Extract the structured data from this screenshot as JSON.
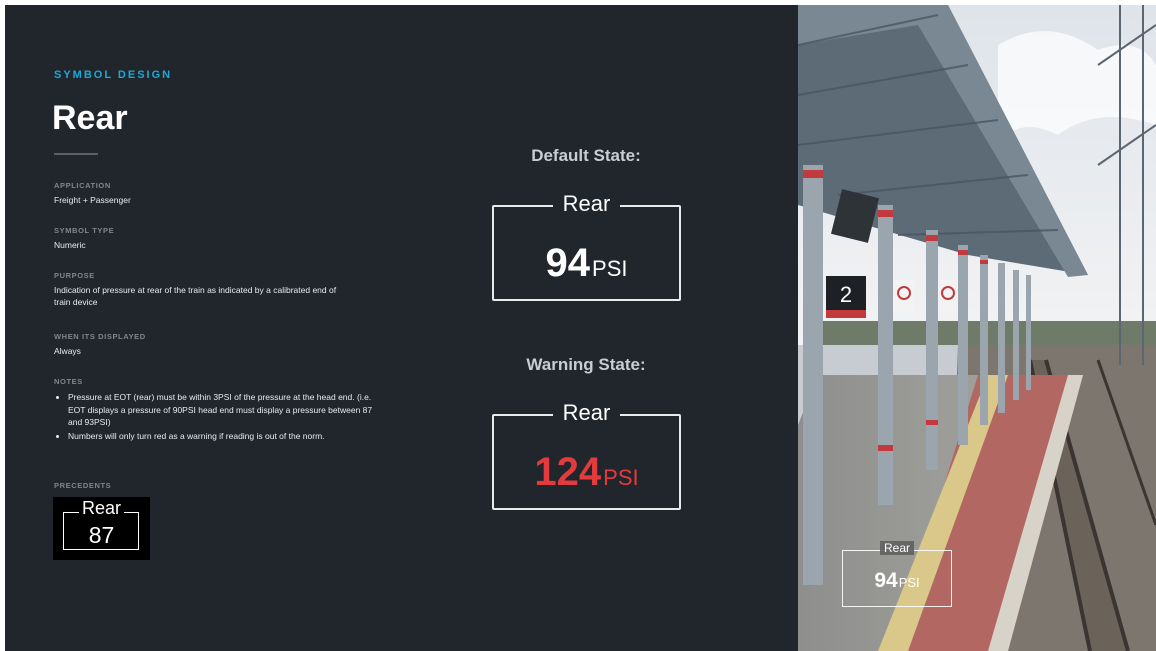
{
  "eyebrow": "SYMBOL DESIGN",
  "title": "Rear",
  "fields": {
    "application": {
      "label": "APPLICATION",
      "value": "Freight + Passenger"
    },
    "symbol_type": {
      "label": "SYMBOL TYPE",
      "value": "Numeric"
    },
    "purpose": {
      "label": "PURPOSE",
      "value": "Indication of pressure at rear of the train as indicated by a calibrated end of train device"
    },
    "when_displayed": {
      "label": "WHEN ITS DISPLAYED",
      "value": "Always"
    },
    "notes": {
      "label": "NOTES",
      "items": [
        "Pressure at EOT (rear) must be within 3PSI of the pressure at the head end. (i.e. EOT displays a pressure of 90PSI head end must display a pressure between 87 and 93PSI)",
        "Numbers will only turn red as a warning if reading is out of the norm."
      ]
    },
    "precedents": {
      "label": "PRECEDENTS",
      "symbol_label": "Rear",
      "symbol_value": "87"
    }
  },
  "default_state": {
    "heading": "Default State:",
    "label": "Rear",
    "value": "94",
    "unit": "PSI",
    "value_color": "#ffffff"
  },
  "warning_state": {
    "heading": "Warning State:",
    "label": "Rear",
    "value": "124",
    "unit": "PSI",
    "value_color": "#e23b3d"
  },
  "photo_overlay": {
    "label": "Rear",
    "value": "94",
    "unit": "PSI"
  },
  "photo_sign": {
    "platform_number": "2"
  },
  "colors": {
    "background": "#21262d",
    "accent": "#1fa8d6",
    "warning": "#e23b3d"
  }
}
